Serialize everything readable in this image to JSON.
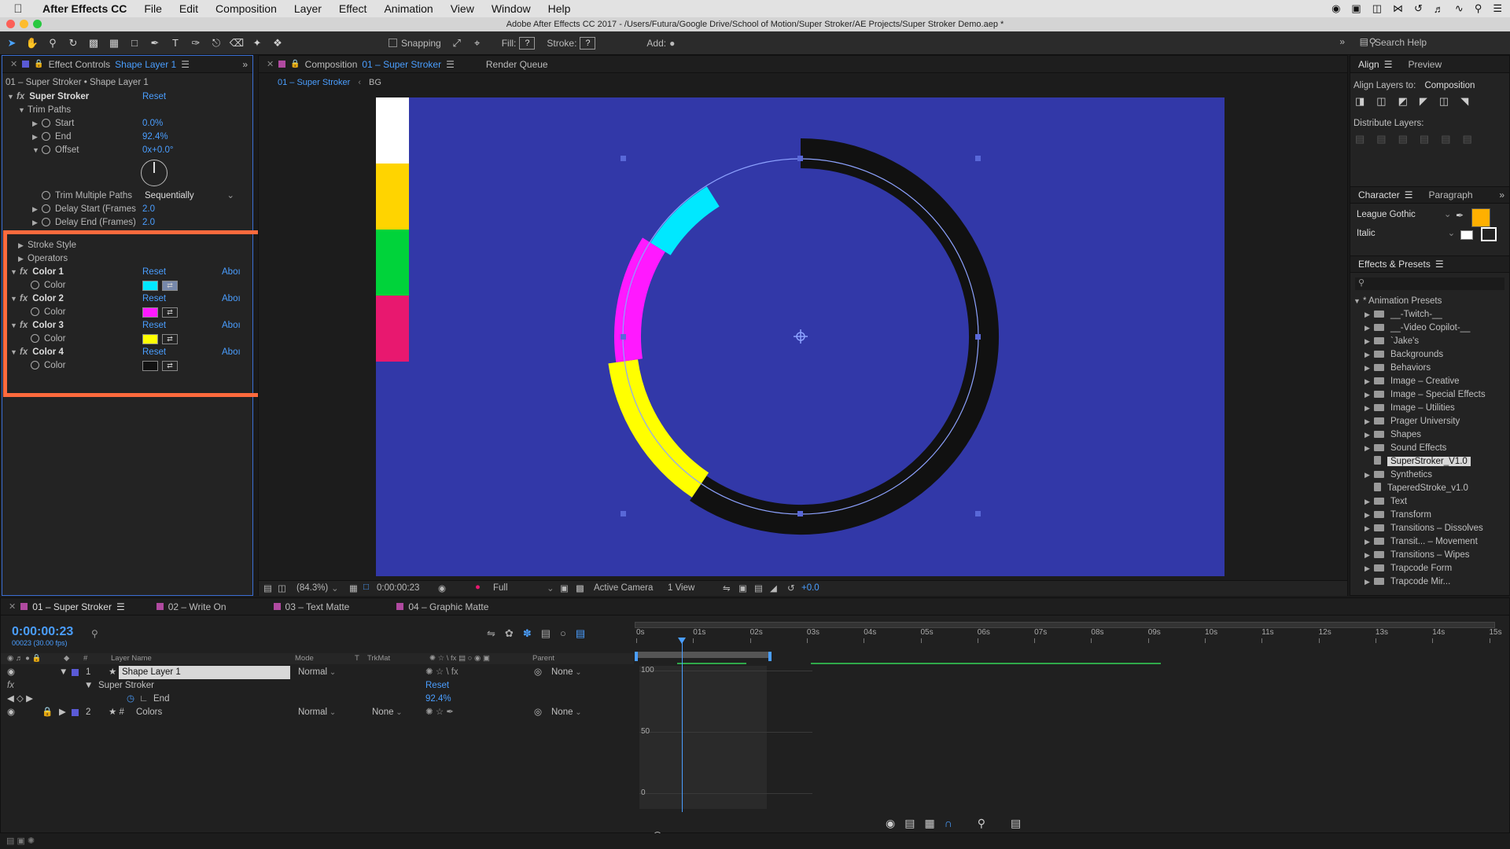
{
  "menubar": {
    "apple": "",
    "app": "After Effects CC",
    "items": [
      "File",
      "Edit",
      "Composition",
      "Layer",
      "Effect",
      "Animation",
      "View",
      "Window",
      "Help"
    ]
  },
  "titlebar": "Adobe After Effects CC 2017 - /Users/Futura/Google Drive/School of Motion/Super Stroker/AE Projects/Super Stroker Demo.aep *",
  "toolbar": {
    "snapping": "Snapping",
    "fill": "Fill:",
    "stroke": "Stroke:",
    "q": "?",
    "add": "Add:",
    "search_help": "Search Help"
  },
  "effect_controls": {
    "tab_title": "Effect Controls",
    "tab_layer": "Shape Layer 1",
    "breadcrumb": "01 – Super Stroker • Shape Layer 1",
    "effect": "Super Stroker",
    "reset": "Reset",
    "about": "Aboı",
    "trim_paths": "Trim Paths",
    "start_label": "Start",
    "start_val": "0.0%",
    "end_label": "End",
    "end_val": "92.4%",
    "offset_label": "Offset",
    "offset_val": "0x+0.0°",
    "trim_multiple_label": "Trim Multiple Paths",
    "trim_multiple_val": "Sequentially",
    "delay_start_label": "Delay Start (Frames",
    "delay_start_val": "2.0",
    "delay_end_label": "Delay End (Frames)",
    "delay_end_val": "2.0",
    "stroke_style": "Stroke Style",
    "operators": "Operators",
    "colors": [
      {
        "name": "Color 1",
        "label": "Color",
        "swatch": "#00e8ff"
      },
      {
        "name": "Color 2",
        "label": "Color",
        "swatch": "#ff19ff"
      },
      {
        "name": "Color 3",
        "label": "Color",
        "swatch": "#ffff00"
      },
      {
        "name": "Color 4",
        "label": "Color",
        "swatch": "#111111"
      }
    ]
  },
  "composition": {
    "tab_title": "Composition",
    "tab_name": "01 – Super Stroker",
    "render_queue": "Render Queue",
    "crumb_active": "01 – Super Stroker",
    "crumb_other": "BG",
    "bg": "#3238a8",
    "footer": {
      "zoom": "(84.3%)",
      "time": "0:00:00:23",
      "quality": "Full",
      "camera": "Active Camera",
      "views": "1 View",
      "exposure": "+0.0"
    },
    "bars": [
      "#ffffff",
      "#ffd400",
      "#00d33a",
      "#e8186f"
    ]
  },
  "right": {
    "align": "Align",
    "preview": "Preview",
    "align_to_label": "Align Layers to:",
    "align_to_val": "Composition",
    "distribute": "Distribute Layers:",
    "character": "Character",
    "paragraph": "Paragraph",
    "font": "League Gothic",
    "style": "Italic",
    "fill_color": "#ffb000",
    "effects_presets": "Effects & Presets",
    "presets_root": "* Animation Presets",
    "presets": [
      "__-Twitch-__",
      "__-Video Copilot-__",
      "`Jake's",
      "Backgrounds",
      "Behaviors",
      "Image – Creative",
      "Image – Special Effects",
      "Image – Utilities",
      "Prager University",
      "Shapes",
      "Sound Effects",
      "SuperStroker_V1.0",
      "Synthetics",
      "TaperedStroke_v1.0",
      "Text",
      "Transform",
      "Transitions – Dissolves",
      "Transit... – Movement",
      "Transitions – Wipes",
      "Trapcode Form",
      "Trapcode Mir..."
    ]
  },
  "timeline": {
    "tabs": [
      "01 – Super Stroker",
      "02 – Write On",
      "03 – Text Matte",
      "04 – Graphic Matte"
    ],
    "timecode": "0:00:00:23",
    "timecode_sub": "00023 (30.00 fps)",
    "cols": {
      "layer_name": "Layer Name",
      "mode": "Mode",
      "t": "T",
      "trkmat": "TrkMat",
      "parent": "Parent"
    },
    "layers": [
      {
        "num": "1",
        "name": "Shape Layer 1",
        "mode": "Normal",
        "parent": "None"
      },
      {
        "num": "2",
        "name": "Colors",
        "mode": "Normal",
        "trkmat": "None",
        "parent": "None"
      }
    ],
    "sub_effect": "Super Stroker",
    "sub_reset": "Reset",
    "end_label": "End",
    "end_val": "92.4%",
    "ruler": [
      "0s",
      "01s",
      "02s",
      "03s",
      "04s",
      "05s",
      "06s",
      "07s",
      "08s",
      "09s",
      "10s",
      "11s",
      "12s",
      "13s",
      "14s",
      "15s"
    ],
    "graph_labels": [
      "100",
      "50",
      "0"
    ]
  }
}
